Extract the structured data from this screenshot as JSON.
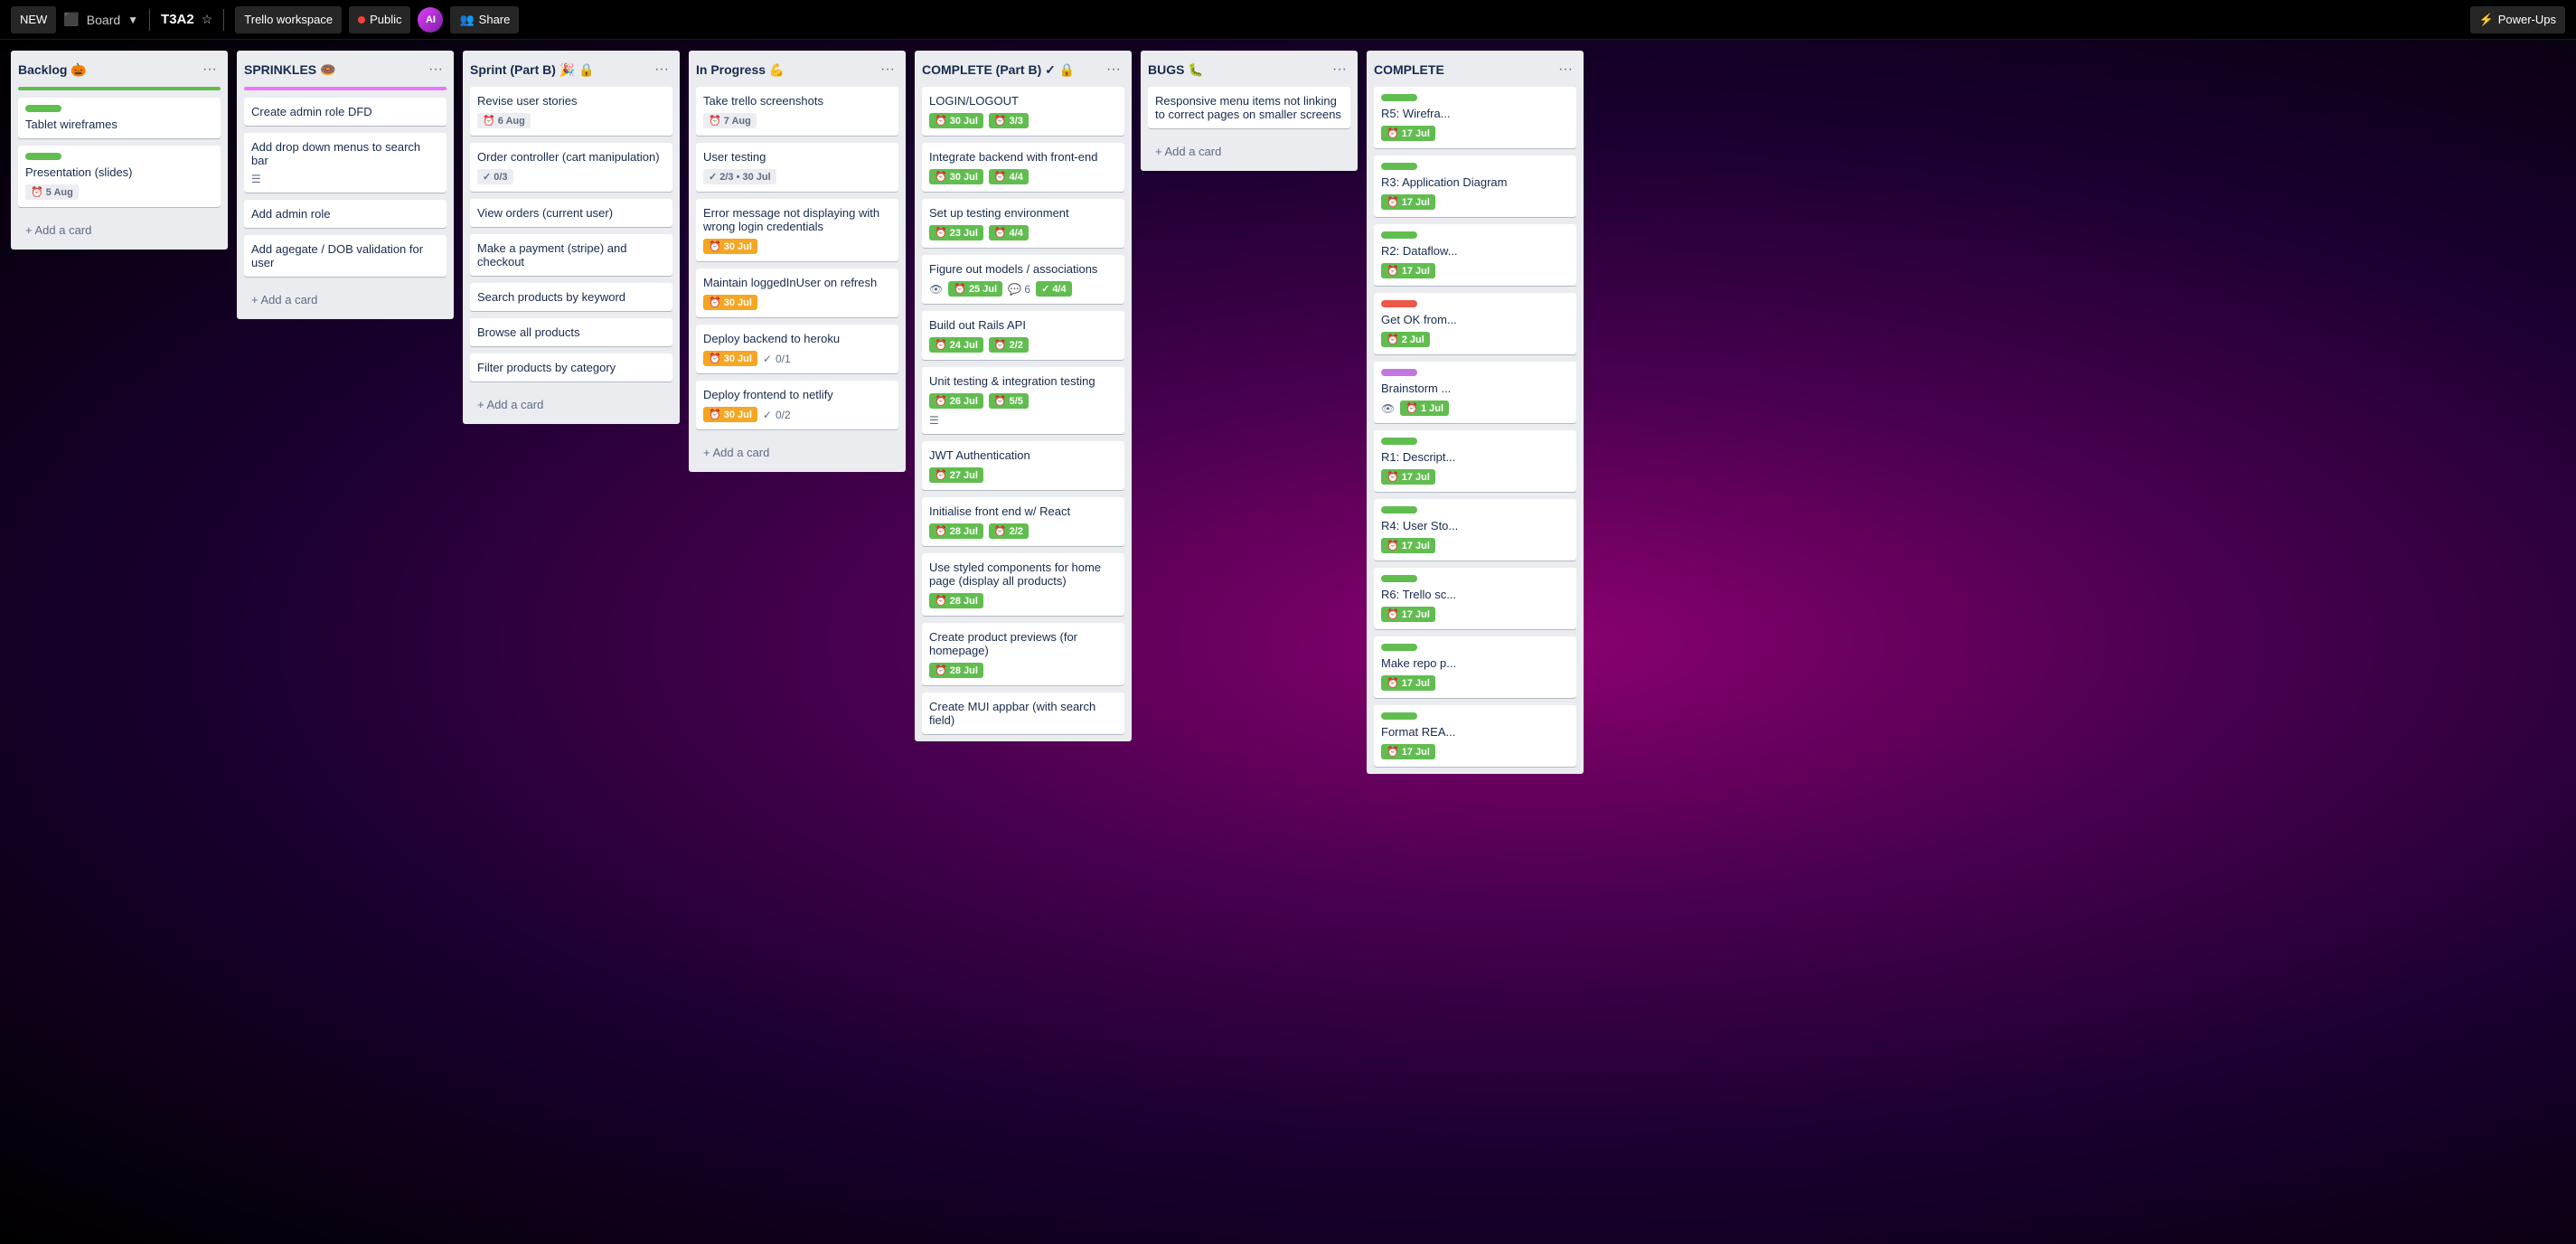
{
  "header": {
    "new_label": "NEW",
    "board_label": "Board",
    "title": "T3A2",
    "workspace": "Trello workspace",
    "visibility": "Public",
    "share": "Share",
    "power_ups": "Power-Ups",
    "avatar_initials": "AI"
  },
  "columns": [
    {
      "id": "backlog",
      "title": "Backlog 🎃",
      "bar_color": "bar-green",
      "cards": [
        {
          "id": "tablet-wireframes",
          "label_color": "label-green",
          "title": "Tablet wireframes",
          "meta": []
        },
        {
          "id": "presentation-slides",
          "label_color": "label-green",
          "title": "Presentation (slides)",
          "meta": [
            {
              "type": "date",
              "value": "5 Aug",
              "style": "outline"
            }
          ]
        }
      ],
      "add_label": "+ Add a card"
    },
    {
      "id": "sprinkles",
      "title": "SPRINKLES 🍩",
      "bar_color": "bar-pink",
      "cards": [
        {
          "id": "create-admin-dfd",
          "title": "Create admin role DFD",
          "meta": []
        },
        {
          "id": "add-dropdown-menus",
          "title": "Add drop down menus to search bar",
          "meta": [
            {
              "type": "lines",
              "value": ""
            }
          ]
        },
        {
          "id": "add-admin-role",
          "title": "Add admin role",
          "meta": []
        },
        {
          "id": "add-dob-validation",
          "title": "Add agegate / DOB validation for user",
          "meta": []
        }
      ],
      "add_label": "+ Add a card"
    },
    {
      "id": "sprint-b",
      "title": "Sprint (Part B) 🎉 🔒",
      "bar_color": "",
      "cards": [
        {
          "id": "revise-user-stories",
          "title": "Revise user stories",
          "meta": [
            {
              "type": "date",
              "value": "6 Aug",
              "style": "outline"
            }
          ]
        },
        {
          "id": "order-controller",
          "title": "Order controller (cart manipulation)",
          "meta": [
            {
              "type": "check",
              "value": "0/3",
              "style": "outline"
            }
          ]
        },
        {
          "id": "view-orders",
          "title": "View orders (current user)",
          "meta": []
        },
        {
          "id": "make-payment",
          "title": "Make a payment (stripe) and checkout",
          "meta": []
        },
        {
          "id": "search-products",
          "title": "Search products by keyword",
          "meta": []
        },
        {
          "id": "browse-products",
          "title": "Browse all products",
          "meta": []
        },
        {
          "id": "filter-products",
          "title": "Filter products by category",
          "meta": []
        }
      ],
      "add_label": "+ Add a card"
    },
    {
      "id": "in-progress",
      "title": "In Progress 💪",
      "bar_color": "",
      "cards": [
        {
          "id": "take-screenshots",
          "title": "Take trello screenshots",
          "meta": [
            {
              "type": "date",
              "value": "7 Aug",
              "style": "outline"
            }
          ]
        },
        {
          "id": "user-testing",
          "title": "User testing",
          "meta": [
            {
              "type": "check",
              "value": "2/3 • 30 Jul",
              "style": "outline"
            }
          ]
        },
        {
          "id": "error-message",
          "title": "Error message not displaying with wrong login credentials",
          "badge": {
            "value": "30 Jul",
            "style": "badge-yellow"
          },
          "meta": []
        },
        {
          "id": "maintain-logged-in",
          "title": "Maintain loggedInUser on refresh",
          "badge": {
            "value": "30 Jul",
            "style": "badge-yellow"
          },
          "meta": []
        },
        {
          "id": "deploy-backend",
          "title": "Deploy backend to heroku",
          "badge": {
            "value": "30 Jul",
            "style": "badge-yellow"
          },
          "checklist": "0/1",
          "meta": []
        },
        {
          "id": "deploy-frontend",
          "title": "Deploy frontend to netlify",
          "badge": {
            "value": "30 Jul",
            "style": "badge-yellow"
          },
          "checklist": "0/2",
          "meta": []
        }
      ],
      "add_label": "+ Add a card"
    },
    {
      "id": "complete-b",
      "title": "COMPLETE (Part B) ✓ 🔒",
      "bar_color": "",
      "cards": [
        {
          "id": "login-logout",
          "title": "LOGIN/LOGOUT",
          "badges": [
            {
              "value": "30 Jul",
              "style": "badge-green"
            },
            {
              "value": "3/3",
              "style": "badge-green"
            }
          ]
        },
        {
          "id": "integrate-backend",
          "title": "Integrate backend with front-end",
          "badges": [
            {
              "value": "30 Jul",
              "style": "badge-green"
            },
            {
              "value": "4/4",
              "style": "badge-green"
            }
          ]
        },
        {
          "id": "set-up-testing",
          "title": "Set up testing environment",
          "badges": [
            {
              "value": "23 Jul",
              "style": "badge-green"
            },
            {
              "value": "4/4",
              "style": "badge-green"
            }
          ]
        },
        {
          "id": "figure-out-models",
          "title": "Figure out models / associations",
          "meta_special": {
            "eye": true,
            "date": "25 Jul",
            "comment": "6",
            "check": "4/4"
          }
        },
        {
          "id": "build-rails-api",
          "title": "Build out Rails API",
          "badges": [
            {
              "value": "24 Jul",
              "style": "badge-green"
            },
            {
              "value": "2/2",
              "style": "badge-green"
            }
          ]
        },
        {
          "id": "unit-testing",
          "title": "Unit testing & integration testing",
          "badges": [
            {
              "value": "26 Jul",
              "style": "badge-green"
            },
            {
              "value": "5/5",
              "style": "badge-green"
            }
          ],
          "has_lines": true
        },
        {
          "id": "jwt-auth",
          "title": "JWT Authentication",
          "badges": [
            {
              "value": "27 Jul",
              "style": "badge-green"
            }
          ]
        },
        {
          "id": "init-frontend",
          "title": "Initialise front end w/ React",
          "badges": [
            {
              "value": "28 Jul",
              "style": "badge-green"
            },
            {
              "value": "2/2",
              "style": "badge-green"
            }
          ]
        },
        {
          "id": "styled-components",
          "title": "Use styled components for home page (display all products)",
          "badges": [
            {
              "value": "28 Jul",
              "style": "badge-green"
            }
          ]
        },
        {
          "id": "product-previews",
          "title": "Create product previews (for homepage)",
          "badges": [
            {
              "value": "28 Jul",
              "style": "badge-green"
            }
          ]
        },
        {
          "id": "create-mui-appbar",
          "title": "Create MUI appbar (with search field)",
          "badges": []
        }
      ],
      "add_label": ""
    },
    {
      "id": "bugs",
      "title": "BUGS 🐛",
      "bar_color": "",
      "cards": [
        {
          "id": "responsive-menu",
          "title": "Responsive menu items not linking to correct pages on smaller screens",
          "meta": []
        }
      ],
      "add_label": "+ Add a card"
    },
    {
      "id": "complete-right",
      "title": "COMPLETE",
      "bar_color": "",
      "cards": [
        {
          "id": "r5-wireframes",
          "label_color": "label-green",
          "title": "R5: Wirefra...",
          "badges": [
            {
              "value": "17 Jul",
              "style": "badge-green"
            }
          ]
        },
        {
          "id": "r3-application",
          "label_color": "label-green",
          "title": "R3: Application Diagram",
          "badges": [
            {
              "value": "17 Jul",
              "style": "badge-green"
            }
          ]
        },
        {
          "id": "r2-dataflow",
          "label_color": "label-green",
          "title": "R2: Dataflow...",
          "badges": [
            {
              "value": "17 Jul",
              "style": "badge-green"
            }
          ]
        },
        {
          "id": "get-ok-from",
          "label_color": "label-red",
          "title": "Get OK from...",
          "badges": [
            {
              "value": "2 Jul",
              "style": "badge-green"
            }
          ]
        },
        {
          "id": "brainstorm",
          "label_color": "label-purple",
          "title": "Brainstorm ...",
          "meta_special": {
            "eye": true,
            "date": "1 Jul",
            "style": "badge-green"
          }
        },
        {
          "id": "r1-description",
          "label_color": "label-green",
          "title": "R1: Descript...",
          "badges": [
            {
              "value": "17 Jul",
              "style": "badge-green"
            }
          ]
        },
        {
          "id": "r4-user-stories",
          "label_color": "label-green",
          "title": "R4: User Sto...",
          "badges": [
            {
              "value": "17 Jul",
              "style": "badge-green"
            }
          ]
        },
        {
          "id": "r6-trello",
          "label_color": "label-green",
          "title": "R6: Trello sc...",
          "badges": [
            {
              "value": "17 Jul",
              "style": "badge-green"
            }
          ]
        },
        {
          "id": "make-repo",
          "label_color": "label-green",
          "title": "Make repo p...",
          "badges": [
            {
              "value": "17 Jul",
              "style": "badge-green"
            }
          ]
        },
        {
          "id": "format-rea",
          "label_color": "label-green",
          "title": "Format REA...",
          "badges": [
            {
              "value": "17 Jul",
              "style": "badge-green"
            }
          ]
        }
      ],
      "add_label": ""
    }
  ]
}
